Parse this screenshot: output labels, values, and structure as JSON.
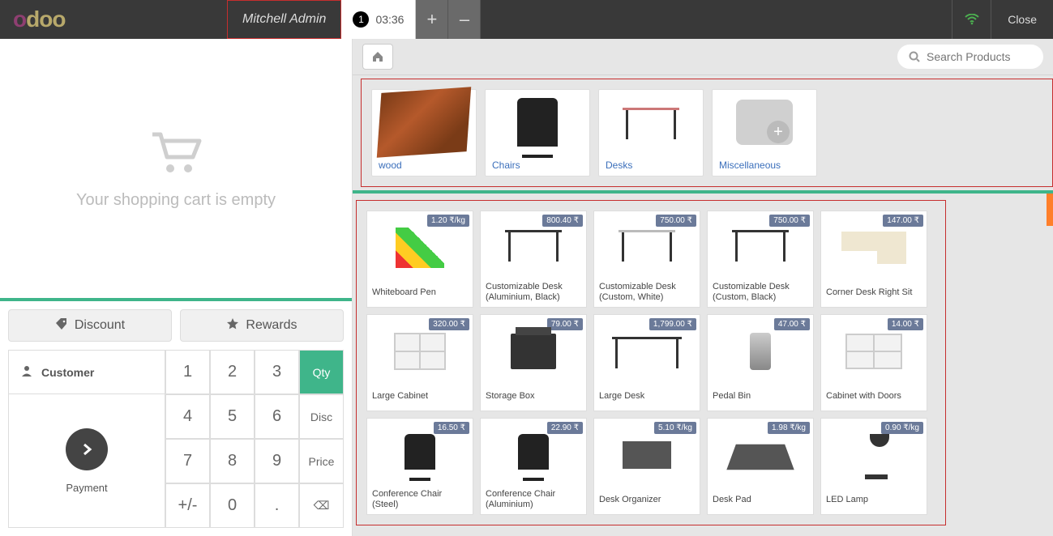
{
  "header": {
    "user": "Mitchell Admin",
    "order_number": "1",
    "order_time": "03:36",
    "plus": "+",
    "minus": "–",
    "close": "Close"
  },
  "cart": {
    "empty_text": "Your shopping cart is empty"
  },
  "buttons": {
    "discount": "Discount",
    "rewards": "Rewards",
    "customer": "Customer",
    "payment": "Payment"
  },
  "keypad": {
    "k1": "1",
    "k2": "2",
    "k3": "3",
    "qty": "Qty",
    "k4": "4",
    "k5": "5",
    "k6": "6",
    "disc": "Disc",
    "k7": "7",
    "k8": "8",
    "k9": "9",
    "price": "Price",
    "pm": "+/-",
    "k0": "0",
    "dot": ".",
    "bs": "⌫"
  },
  "search": {
    "placeholder": "Search Products"
  },
  "categories": [
    {
      "label": "wood"
    },
    {
      "label": "Chairs"
    },
    {
      "label": "Desks"
    },
    {
      "label": "Miscellaneous"
    }
  ],
  "products": [
    {
      "price": "1.20 ₹/kg",
      "name": "Whiteboard Pen"
    },
    {
      "price": "800.40 ₹",
      "name": "Customizable Desk (Aluminium, Black)"
    },
    {
      "price": "750.00 ₹",
      "name": "Customizable Desk (Custom, White)"
    },
    {
      "price": "750.00 ₹",
      "name": "Customizable Desk (Custom, Black)"
    },
    {
      "price": "147.00 ₹",
      "name": "Corner Desk Right Sit"
    },
    {
      "price": "320.00 ₹",
      "name": "Large Cabinet"
    },
    {
      "price": "79.00 ₹",
      "name": "Storage Box"
    },
    {
      "price": "1,799.00 ₹",
      "name": "Large Desk"
    },
    {
      "price": "47.00 ₹",
      "name": "Pedal Bin"
    },
    {
      "price": "14.00 ₹",
      "name": "Cabinet with Doors"
    },
    {
      "price": "16.50 ₹",
      "name": "Conference Chair (Steel)"
    },
    {
      "price": "22.90 ₹",
      "name": "Conference Chair (Aluminium)"
    },
    {
      "price": "5.10 ₹/kg",
      "name": "Desk Organizer"
    },
    {
      "price": "1.98 ₹/kg",
      "name": "Desk Pad"
    },
    {
      "price": "0.90 ₹/kg",
      "name": "LED Lamp"
    }
  ]
}
